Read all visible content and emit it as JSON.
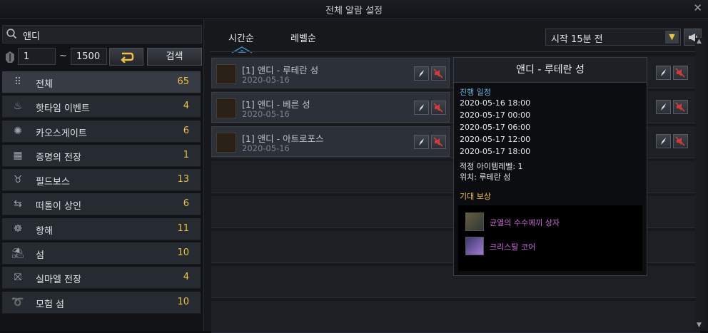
{
  "window": {
    "title": "전체 알람 설정"
  },
  "search": {
    "value": "앤디"
  },
  "level": {
    "min": "1",
    "tilde": "~",
    "max": "1500",
    "search_button": "검색"
  },
  "categories": [
    {
      "label": "전체",
      "count": "65",
      "icon": "grid-icon"
    },
    {
      "label": "핫타임 이벤트",
      "count": "4",
      "icon": "flame-icon"
    },
    {
      "label": "카오스게이트",
      "count": "6",
      "icon": "chaos-gate-icon"
    },
    {
      "label": "증명의 전장",
      "count": "1",
      "icon": "arena-icon"
    },
    {
      "label": "필드보스",
      "count": "13",
      "icon": "field-boss-icon"
    },
    {
      "label": "떠돌이 상인",
      "count": "6",
      "icon": "merchant-icon"
    },
    {
      "label": "항해",
      "count": "11",
      "icon": "ship-wheel-icon"
    },
    {
      "label": "섬",
      "count": "10",
      "icon": "island-icon"
    },
    {
      "label": "실마엘 전장",
      "count": "4",
      "icon": "silmael-icon"
    },
    {
      "label": "모험 섬",
      "count": "10",
      "icon": "adventure-island-icon"
    }
  ],
  "tabs": [
    {
      "label": "시간순"
    },
    {
      "label": "레벨순"
    }
  ],
  "notify": {
    "selected": "시작 15분 전"
  },
  "events": [
    {
      "name": "[1] 앤디 - 루테란 성",
      "date": "2020-05-16"
    },
    {
      "name": "[1] 앤디 - 베른 성",
      "date": "2020-05-16"
    },
    {
      "name": "[1] 앤디 - 아트로포스",
      "date": "2020-05-16"
    }
  ],
  "tooltip": {
    "title": "앤디 - 루테란 성",
    "schedule_label": "진행 일정",
    "schedule": [
      "2020-05-16 18:00",
      "2020-05-17 00:00",
      "2020-05-17 06:00",
      "2020-05-17 12:00",
      "2020-05-17 18:00"
    ],
    "item_level": "적정 아이템레벨: 1",
    "location": "위치: 루테란 성",
    "reward_label": "기대 보상",
    "rewards": [
      {
        "name": "균열의 수수께끼 상자",
        "color": "#c86ad8"
      },
      {
        "name": "크리스탈 코어",
        "color": "#c86ad8"
      }
    ]
  },
  "colors": {
    "accent": "#e8c244",
    "highlight_blue": "#6fb2dd",
    "reward_purple": "#c86ad8"
  }
}
